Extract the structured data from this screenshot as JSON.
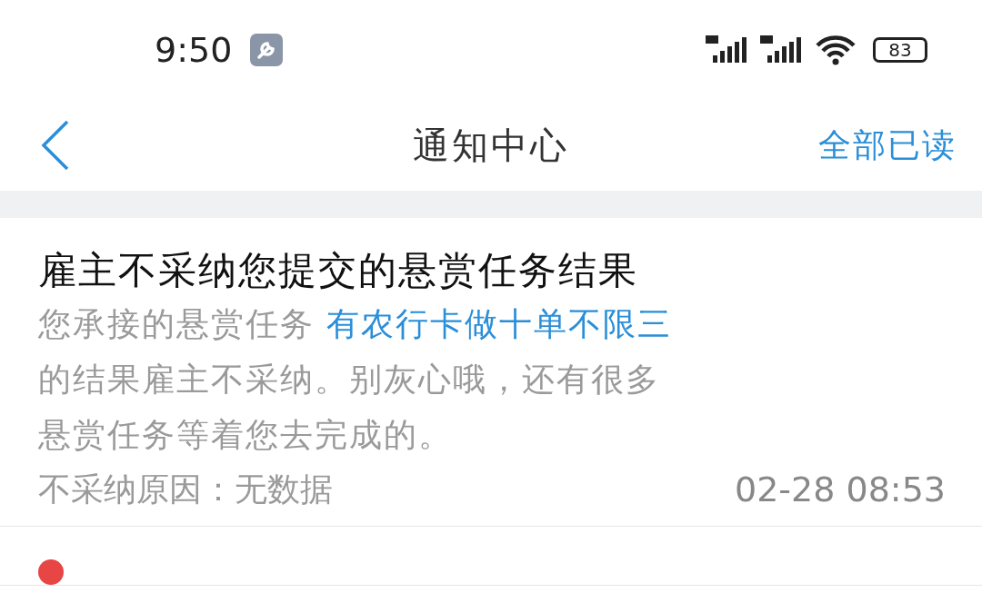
{
  "status_bar": {
    "time": "9:50",
    "battery": "83"
  },
  "nav": {
    "title": "通知中心",
    "action": "全部已读"
  },
  "notifications": [
    {
      "title": "雇主不采纳您提交的悬赏任务结果",
      "unread": false,
      "body_before": "您承接的悬赏任务 ",
      "link": "有农行卡做十单不限三",
      "body_after": " 的结果雇主不采纳。别灰心哦，还有很多悬赏任务等着您去完成的。",
      "reason": "不采纳原因：无数据",
      "time": "02-28 08:53"
    },
    {
      "unread": true
    }
  ]
}
